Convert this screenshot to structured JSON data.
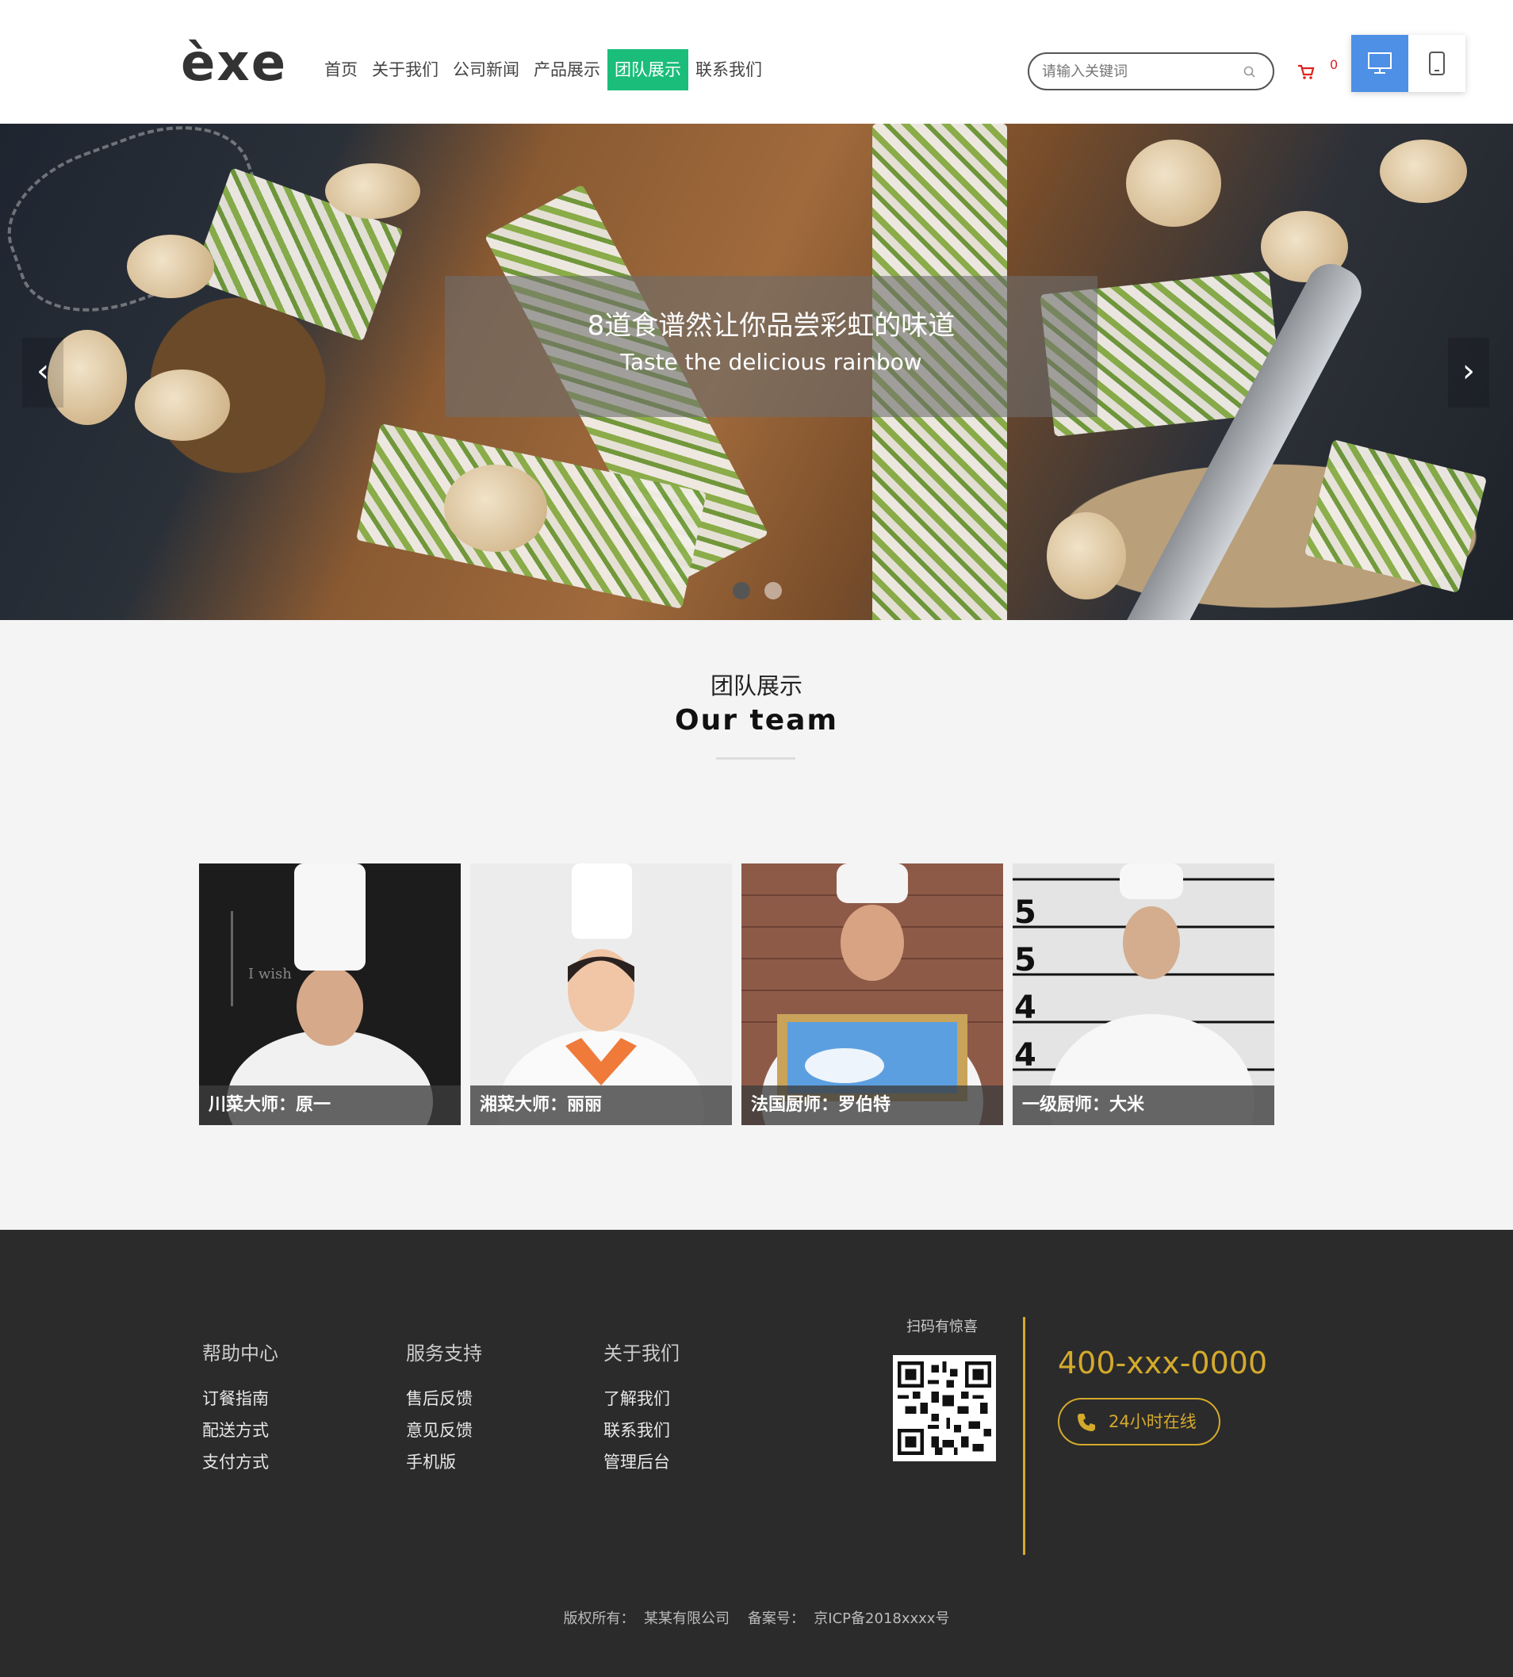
{
  "header": {
    "logo": "èxe",
    "nav": [
      "首页",
      "关于我们",
      "公司新闻",
      "产品展示",
      "团队展示",
      "联系我们"
    ],
    "nav_active": "团队展示",
    "search_placeholder": "请输入关键词",
    "cart_count": "0",
    "device_active": "desktop",
    "accent_color": "#1bbd7a"
  },
  "banner": {
    "title": "8道食谱然让你品尝彩虹的味道",
    "subtitle": "Taste the delicious rainbow",
    "prev_arrow": "‹",
    "next_arrow": "›",
    "slide_count": 2,
    "active_slide": 1
  },
  "team": {
    "title_cn": "团队展示",
    "title_en": "Our team",
    "members": [
      {
        "label": "川菜大师：原一"
      },
      {
        "label": "湘菜大师：丽丽"
      },
      {
        "label": "法国厨师：罗伯特"
      },
      {
        "label": "一级厨师：大米"
      }
    ]
  },
  "footer": {
    "columns": [
      {
        "title": "帮助中心",
        "links": [
          "订餐指南",
          "配送方式",
          "支付方式"
        ]
      },
      {
        "title": "服务支持",
        "links": [
          "售后反馈",
          "意见反馈",
          "手机版"
        ]
      },
      {
        "title": "关于我们",
        "links": [
          "了解我们",
          "联系我们",
          "管理后台"
        ]
      }
    ],
    "qr_title": "扫码有惊喜",
    "phone": "400-xxx-0000",
    "online_label": "24小时在线",
    "copyright": "版权所有：  某某有限公司    备案号：  京ICP备2018xxxx号",
    "gold_color": "#d4aa2c"
  }
}
